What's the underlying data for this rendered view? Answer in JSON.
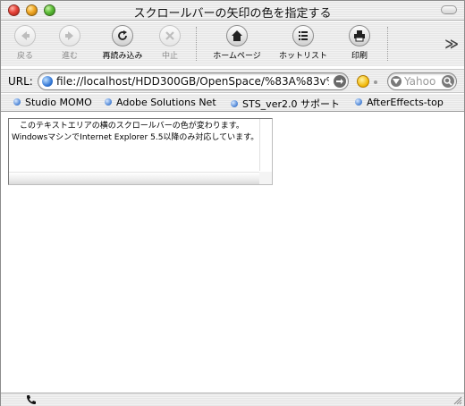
{
  "window": {
    "title": "スクロールバーの矢印の色を指定する"
  },
  "toolbar": {
    "back_label": "戻る",
    "forward_label": "進む",
    "reload_label": "再読み込み",
    "stop_label": "中止",
    "home_label": "ホームページ",
    "hotlist_label": "ホットリスト",
    "print_label": "印刷",
    "more_glyph": "≫"
  },
  "address": {
    "label": "URL:",
    "url": "file://localhost/HDD300GB/OpenSpace/%83A%83v%",
    "search_placeholder": "Yahoo"
  },
  "bookmarks": [
    {
      "label": "Studio MOMO"
    },
    {
      "label": "Adobe Solutions Net"
    },
    {
      "label": "STS_ver2.0 サポート"
    },
    {
      "label": "AfterEffects-top"
    }
  ],
  "content": {
    "textarea_text": "　このテキストエリアの横のスクロールバーの色が変わります。WindowsマシンでInternet Explorer 5.5以降のみ対応しています。"
  },
  "icons": {
    "back": "back-arrow-icon",
    "forward": "forward-arrow-icon",
    "reload": "reload-icon",
    "stop": "stop-x-icon",
    "home": "home-icon",
    "hotlist": "list-icon",
    "print": "printer-icon",
    "status": "phone-icon"
  },
  "colors": {
    "traffic_close": "#e8453c",
    "traffic_minimize": "#f2a825",
    "traffic_zoom": "#5fbf3a",
    "link_dot": "#4f86d6"
  }
}
